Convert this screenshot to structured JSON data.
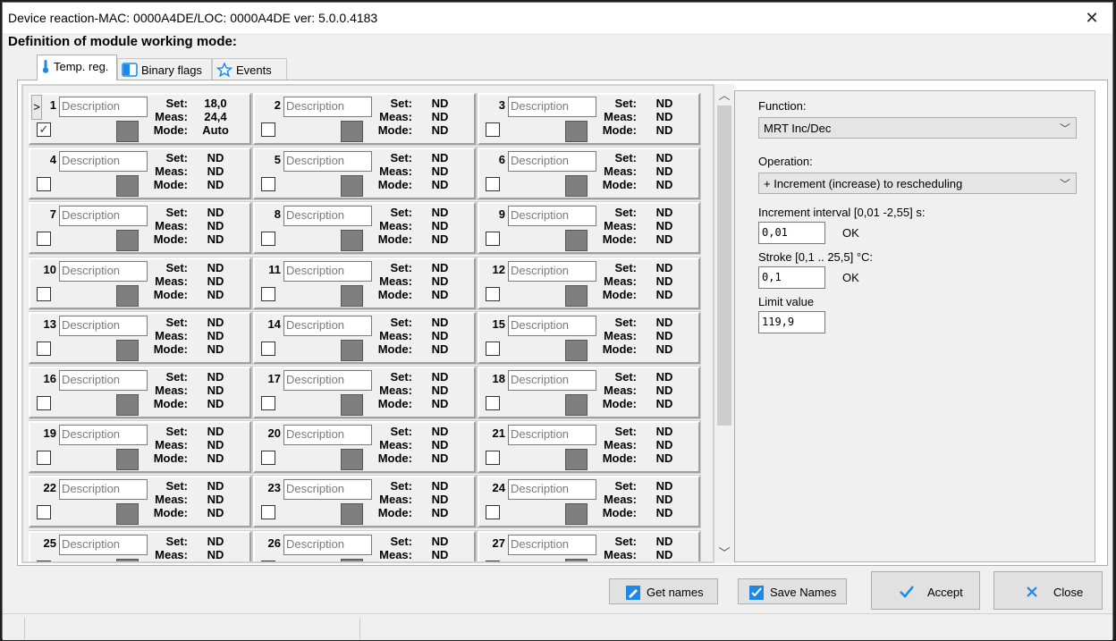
{
  "window": {
    "title": "Device reaction-MAC: 0000A4DE/LOC: 0000A4DE ver: 5.0.0.4183",
    "close_glyph": "✕"
  },
  "heading": "Definition of module working mode:",
  "tabs": [
    {
      "label": "Temp. reg.",
      "icon": "thermometer-icon",
      "active": true
    },
    {
      "label": "Binary flags",
      "icon": "binary-flags-icon",
      "active": false
    },
    {
      "label": "Events",
      "icon": "star-icon",
      "active": false
    }
  ],
  "grid": {
    "description_placeholder": "Description",
    "expand_glyph": ">",
    "labels": {
      "set": "Set:",
      "meas": "Meas:",
      "mode": "Mode:"
    },
    "cells": [
      {
        "n": "1",
        "set": "18,0",
        "meas": "24,4",
        "mode": "Auto",
        "checked": true
      },
      {
        "n": "2",
        "set": "ND",
        "meas": "ND",
        "mode": "ND",
        "checked": false
      },
      {
        "n": "3",
        "set": "ND",
        "meas": "ND",
        "mode": "ND",
        "checked": false
      },
      {
        "n": "4",
        "set": "ND",
        "meas": "ND",
        "mode": "ND",
        "checked": false
      },
      {
        "n": "5",
        "set": "ND",
        "meas": "ND",
        "mode": "ND",
        "checked": false
      },
      {
        "n": "6",
        "set": "ND",
        "meas": "ND",
        "mode": "ND",
        "checked": false
      },
      {
        "n": "7",
        "set": "ND",
        "meas": "ND",
        "mode": "ND",
        "checked": false
      },
      {
        "n": "8",
        "set": "ND",
        "meas": "ND",
        "mode": "ND",
        "checked": false
      },
      {
        "n": "9",
        "set": "ND",
        "meas": "ND",
        "mode": "ND",
        "checked": false
      },
      {
        "n": "10",
        "set": "ND",
        "meas": "ND",
        "mode": "ND",
        "checked": false
      },
      {
        "n": "11",
        "set": "ND",
        "meas": "ND",
        "mode": "ND",
        "checked": false
      },
      {
        "n": "12",
        "set": "ND",
        "meas": "ND",
        "mode": "ND",
        "checked": false
      },
      {
        "n": "13",
        "set": "ND",
        "meas": "ND",
        "mode": "ND",
        "checked": false
      },
      {
        "n": "14",
        "set": "ND",
        "meas": "ND",
        "mode": "ND",
        "checked": false
      },
      {
        "n": "15",
        "set": "ND",
        "meas": "ND",
        "mode": "ND",
        "checked": false
      },
      {
        "n": "16",
        "set": "ND",
        "meas": "ND",
        "mode": "ND",
        "checked": false
      },
      {
        "n": "17",
        "set": "ND",
        "meas": "ND",
        "mode": "ND",
        "checked": false
      },
      {
        "n": "18",
        "set": "ND",
        "meas": "ND",
        "mode": "ND",
        "checked": false
      },
      {
        "n": "19",
        "set": "ND",
        "meas": "ND",
        "mode": "ND",
        "checked": false
      },
      {
        "n": "20",
        "set": "ND",
        "meas": "ND",
        "mode": "ND",
        "checked": false
      },
      {
        "n": "21",
        "set": "ND",
        "meas": "ND",
        "mode": "ND",
        "checked": false
      },
      {
        "n": "22",
        "set": "ND",
        "meas": "ND",
        "mode": "ND",
        "checked": false
      },
      {
        "n": "23",
        "set": "ND",
        "meas": "ND",
        "mode": "ND",
        "checked": false
      },
      {
        "n": "24",
        "set": "ND",
        "meas": "ND",
        "mode": "ND",
        "checked": false
      },
      {
        "n": "25",
        "set": "ND",
        "meas": "ND",
        "mode": "ND",
        "checked": false
      },
      {
        "n": "26",
        "set": "ND",
        "meas": "ND",
        "mode": "ND",
        "checked": false
      },
      {
        "n": "27",
        "set": "ND",
        "meas": "ND",
        "mode": "ND",
        "checked": false
      }
    ]
  },
  "panel": {
    "function_label": "Function:",
    "function_value": "MRT Inc/Dec",
    "operation_label": "Operation:",
    "operation_value": "+ Increment (increase) to rescheduling",
    "increment_label": "Increment interval [0,01 -2,55] s:",
    "increment_value": "0,01",
    "increment_ok": "OK",
    "stroke_label": "Stroke [0,1 .. 25,5] °C:",
    "stroke_value": "0,1",
    "stroke_ok": "OK",
    "limit_label": "Limit value",
    "limit_value": "119,9"
  },
  "buttons": {
    "get_names": "Get names",
    "save_names": "Save Names",
    "accept": "Accept",
    "close": "Close"
  },
  "colors": {
    "accent_blue": "#1e88e5",
    "swatch_gray": "#7f7f7f"
  }
}
